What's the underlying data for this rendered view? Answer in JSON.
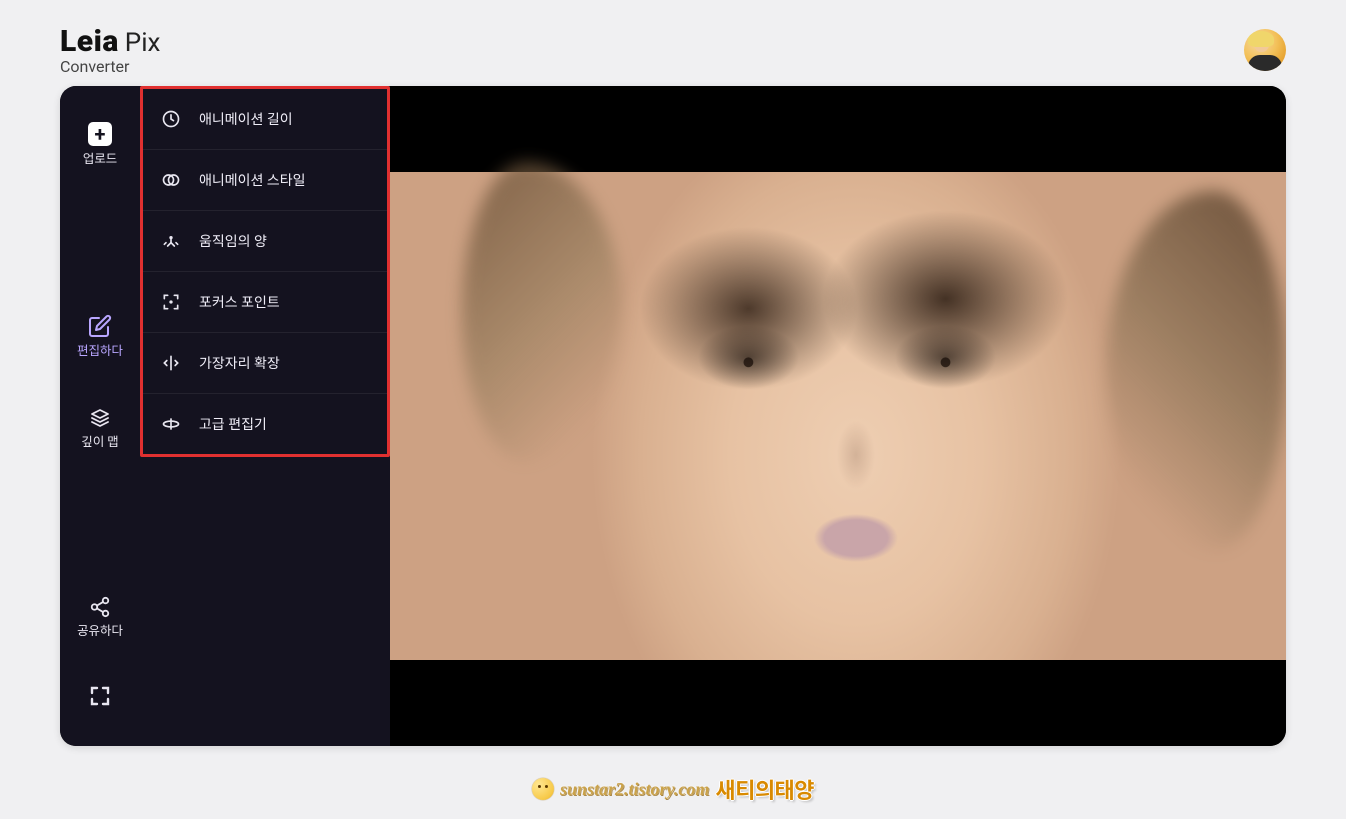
{
  "brand": {
    "name": "Leia",
    "suffix": "Pix",
    "subtitle": "Converter"
  },
  "sidebar": {
    "upload_label": "업로드",
    "edit_label": "편집하다",
    "depth_label": "깊이 맵",
    "share_label": "공유하다"
  },
  "submenu": {
    "items": [
      {
        "icon": "clock",
        "label": "애니메이션 길이"
      },
      {
        "icon": "circles",
        "label": "애니메이션 스타일"
      },
      {
        "icon": "motion",
        "label": "움직임의 양"
      },
      {
        "icon": "focus",
        "label": "포커스 포인트"
      },
      {
        "icon": "edge",
        "label": "가장자리 확장"
      },
      {
        "icon": "advanced",
        "label": "고급 편집기"
      }
    ]
  },
  "footer": {
    "url": "sunstar2.tistory.com",
    "name": "새티의태양"
  }
}
